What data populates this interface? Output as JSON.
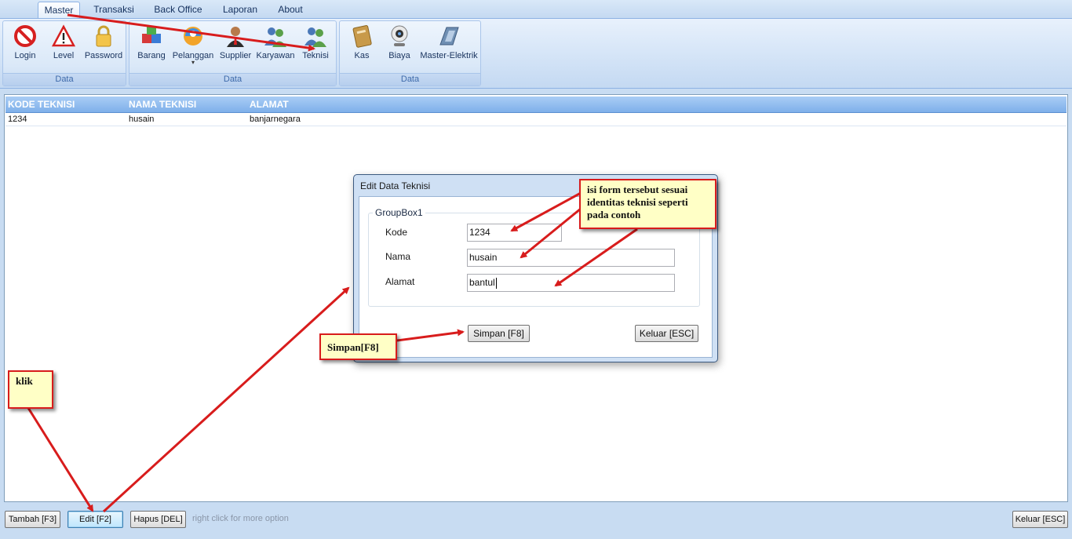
{
  "menu": {
    "tabs": [
      {
        "label": "Master",
        "active": true
      },
      {
        "label": "Transaksi",
        "active": false
      },
      {
        "label": "Back Office",
        "active": false
      },
      {
        "label": "Laporan",
        "active": false
      },
      {
        "label": "About",
        "active": false
      }
    ]
  },
  "ribbon": {
    "groups": [
      {
        "label": "Data",
        "buttons": [
          {
            "label": "Login",
            "icon": "no-entry-icon"
          },
          {
            "label": "Level",
            "icon": "warning-icon"
          },
          {
            "label": "Password",
            "icon": "lock-icon"
          }
        ]
      },
      {
        "label": "Data",
        "buttons": [
          {
            "label": "Barang",
            "icon": "cubes-icon"
          },
          {
            "label": "Pelanggan",
            "icon": "customer-icon"
          },
          {
            "label": "Supplier",
            "icon": "supplier-icon"
          },
          {
            "label": "Karyawan",
            "icon": "users-icon"
          },
          {
            "label": "Teknisi",
            "icon": "users-icon"
          }
        ]
      },
      {
        "label": "Data",
        "buttons": [
          {
            "label": "Kas",
            "icon": "ledger-icon"
          },
          {
            "label": "Biaya",
            "icon": "webcam-icon"
          },
          {
            "label": "Master-Elektrik",
            "icon": "device-icon"
          }
        ]
      }
    ]
  },
  "grid": {
    "columns": [
      "KODE TEKNISI",
      "NAMA TEKNISI",
      "ALAMAT"
    ],
    "rows": [
      [
        "1234",
        "husain",
        "banjarnegara"
      ]
    ]
  },
  "bottom": {
    "tambah_label": "Tambah [F3]",
    "edit_label": "Edit [F2]",
    "hapus_label": "Hapus [DEL]",
    "hint": "right click for more option",
    "keluar_label": "Keluar [ESC]"
  },
  "dialog": {
    "title": "Edit Data Teknisi",
    "groupbox_title": "GroupBox1",
    "kode_label": "Kode",
    "kode_value": "1234",
    "nama_label": "Nama",
    "nama_value": "husain",
    "alamat_label": "Alamat",
    "alamat_value": "bantul",
    "simpan_label": "Simpan [F8]",
    "keluar_label": "Keluar [ESC]"
  },
  "callouts": {
    "isi_form": "isi form tersebut sesuai identitas teknisi seperti pada contoh",
    "simpan": "Simpan[F8]",
    "klik": "klik"
  },
  "colors": {
    "annotation_red": "#d81c1c",
    "callout_fill": "#ffffc6",
    "grid_header": "#7fb0ea"
  }
}
